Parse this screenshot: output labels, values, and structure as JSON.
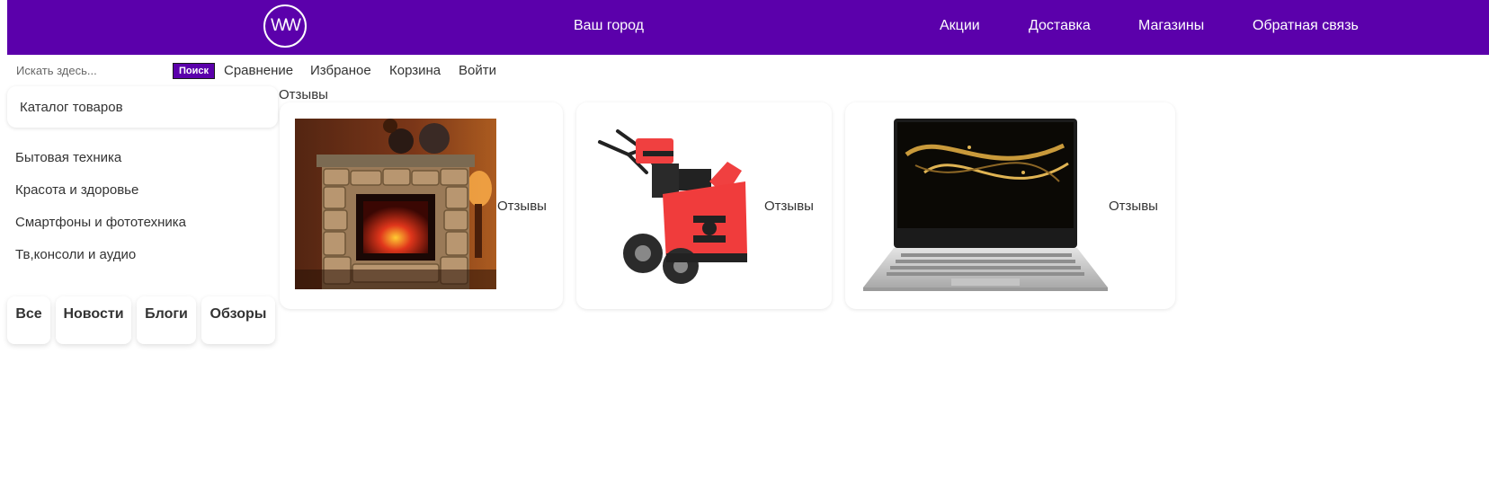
{
  "header": {
    "logo_text": "WW",
    "city_label": "Ваш город",
    "nav": [
      {
        "label": "Акции"
      },
      {
        "label": "Доставка"
      },
      {
        "label": "Магазины"
      },
      {
        "label": "Обратная связь"
      }
    ],
    "brand_color": "#5b00ab"
  },
  "search": {
    "placeholder": "Искать здесь...",
    "button_label": "Поиск"
  },
  "utility_links": [
    {
      "label": "Сравнение"
    },
    {
      "label": "Избраное"
    },
    {
      "label": "Корзина"
    },
    {
      "label": "Войти"
    }
  ],
  "sidebar": {
    "catalog_label": "Каталог товаров",
    "categories": [
      {
        "label": "Бытовая техника"
      },
      {
        "label": "Красота и здоровье"
      },
      {
        "label": "Смартфоны и фототехника"
      },
      {
        "label": "Тв,консоли и аудио"
      }
    ]
  },
  "blog_tabs": [
    {
      "label": "Все"
    },
    {
      "label": "Новости"
    },
    {
      "label": "Блоги"
    },
    {
      "label": "Обзоры"
    }
  ],
  "main": {
    "section_title": "Отзывы",
    "products": [
      {
        "image_icon": "fireplace-image",
        "label": "Отзывы"
      },
      {
        "image_icon": "snowblower-image",
        "label": "Отзывы"
      },
      {
        "image_icon": "laptop-image",
        "label": "Отзывы"
      }
    ]
  }
}
